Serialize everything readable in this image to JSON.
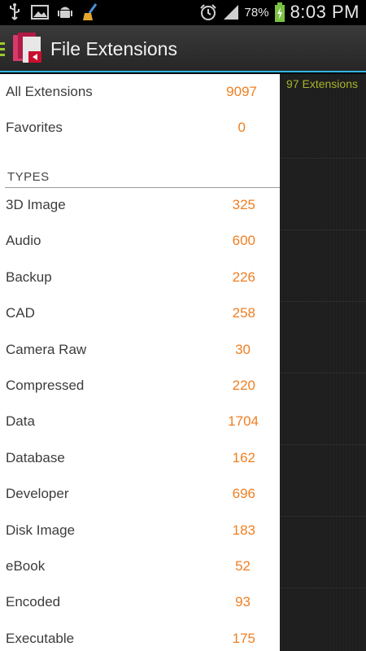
{
  "status_bar": {
    "icons": [
      "usb-icon",
      "image-icon",
      "android-icon",
      "broom-icon"
    ],
    "alarm_icon": "alarm-clock-icon",
    "signal_icon": "signal-icon",
    "battery_percent": "78%",
    "battery_icon": "battery-charging-icon",
    "time": "8:03 PM"
  },
  "action_bar": {
    "title": "File Extensions",
    "accent_color": "#33b5e5",
    "drawer_indicator_color": "#9ccc2a"
  },
  "background": {
    "count_text": "97 Extensions"
  },
  "drawer": {
    "top_items": [
      {
        "label": "All Extensions",
        "count": "9097"
      },
      {
        "label": "Favorites",
        "count": "0"
      }
    ],
    "section_title": "TYPES",
    "types": [
      {
        "label": "3D Image",
        "count": "325"
      },
      {
        "label": "Audio",
        "count": "600"
      },
      {
        "label": "Backup",
        "count": "226"
      },
      {
        "label": "CAD",
        "count": "258"
      },
      {
        "label": "Camera Raw",
        "count": "30"
      },
      {
        "label": "Compressed",
        "count": "220"
      },
      {
        "label": "Data",
        "count": "1704"
      },
      {
        "label": "Database",
        "count": "162"
      },
      {
        "label": "Developer",
        "count": "696"
      },
      {
        "label": "Disk Image",
        "count": "183"
      },
      {
        "label": "eBook",
        "count": "52"
      },
      {
        "label": "Encoded",
        "count": "93"
      },
      {
        "label": "Executable",
        "count": "175"
      }
    ],
    "count_color": "#f07f22"
  }
}
